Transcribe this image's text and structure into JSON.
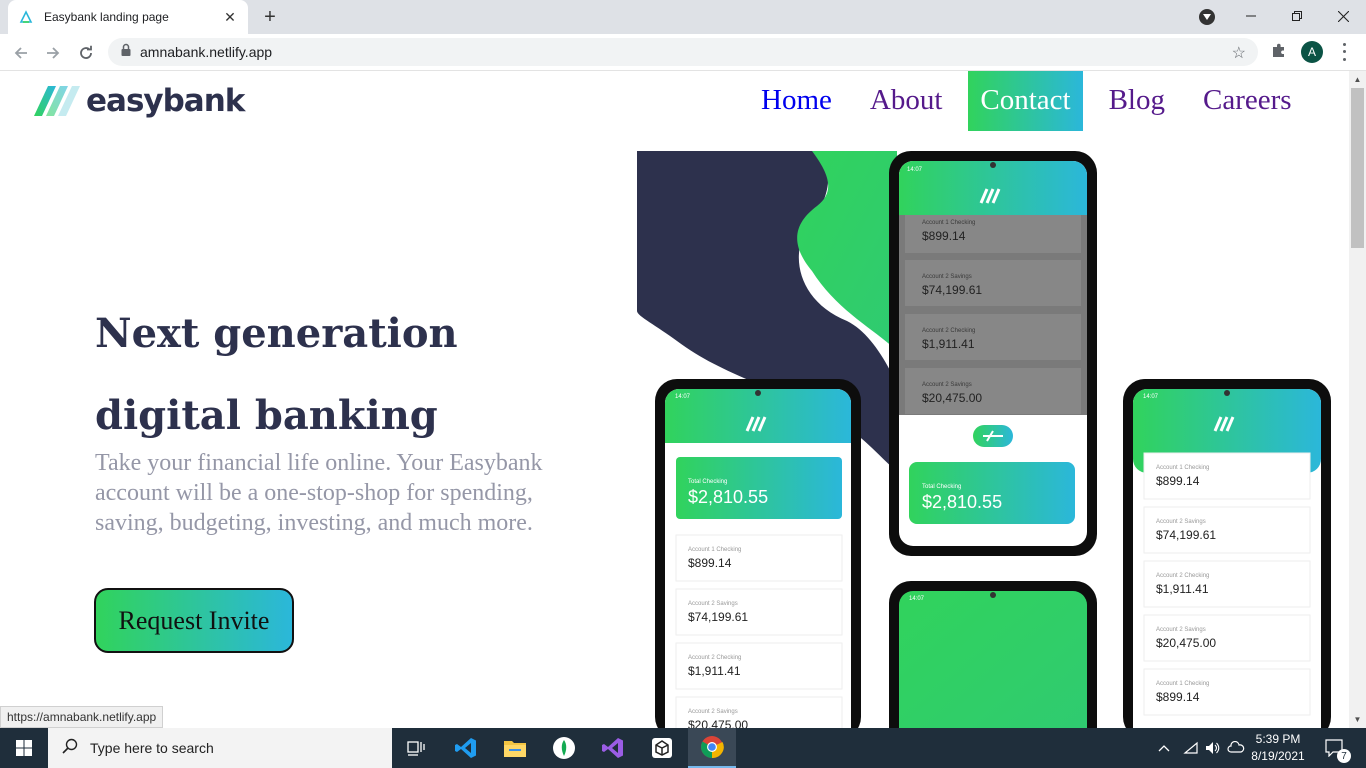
{
  "browser": {
    "tab_title": "Easybank landing page",
    "url": "amnabank.netlify.app",
    "profile_initial": "A",
    "status_url": "https://amnabank.netlify.app"
  },
  "site": {
    "logo_text": "easybank",
    "nav": [
      "Home",
      "About",
      "Contact",
      "Blog",
      "Careers"
    ],
    "active_nav": "Contact",
    "hero_title": "Next generation digital banking",
    "hero_text": "Take your financial life online. Your Easybank account will be a one-stop-shop for spending, saving, budgeting, investing, and much more.",
    "cta_label": "Request Invite"
  },
  "phones": {
    "time": "14:07",
    "total_label": "Total Checking",
    "total_value": "$2,810.55",
    "accounts": [
      {
        "label": "Account 1 Checking",
        "value": "$899.14"
      },
      {
        "label": "Account 2 Savings",
        "value": "$74,199.61"
      },
      {
        "label": "Account 2 Checking",
        "value": "$1,911.41"
      },
      {
        "label": "Account 2 Savings",
        "value": "$20,475.00"
      },
      {
        "label": "Account 1 Checking",
        "value": "$899.14"
      }
    ]
  },
  "colors": {
    "brand_green": "#31d35c",
    "brand_cyan": "#2bb7da",
    "dark_blue": "#2d314d",
    "grayish_blue": "#9597a7"
  },
  "taskbar": {
    "search_placeholder": "Type here to search",
    "time": "5:39 PM",
    "date": "8/19/2021",
    "notification_count": "7",
    "apps": [
      "task-view",
      "vscode",
      "file-explorer",
      "mongodb-compass",
      "visual-studio",
      "unity",
      "chrome"
    ]
  }
}
